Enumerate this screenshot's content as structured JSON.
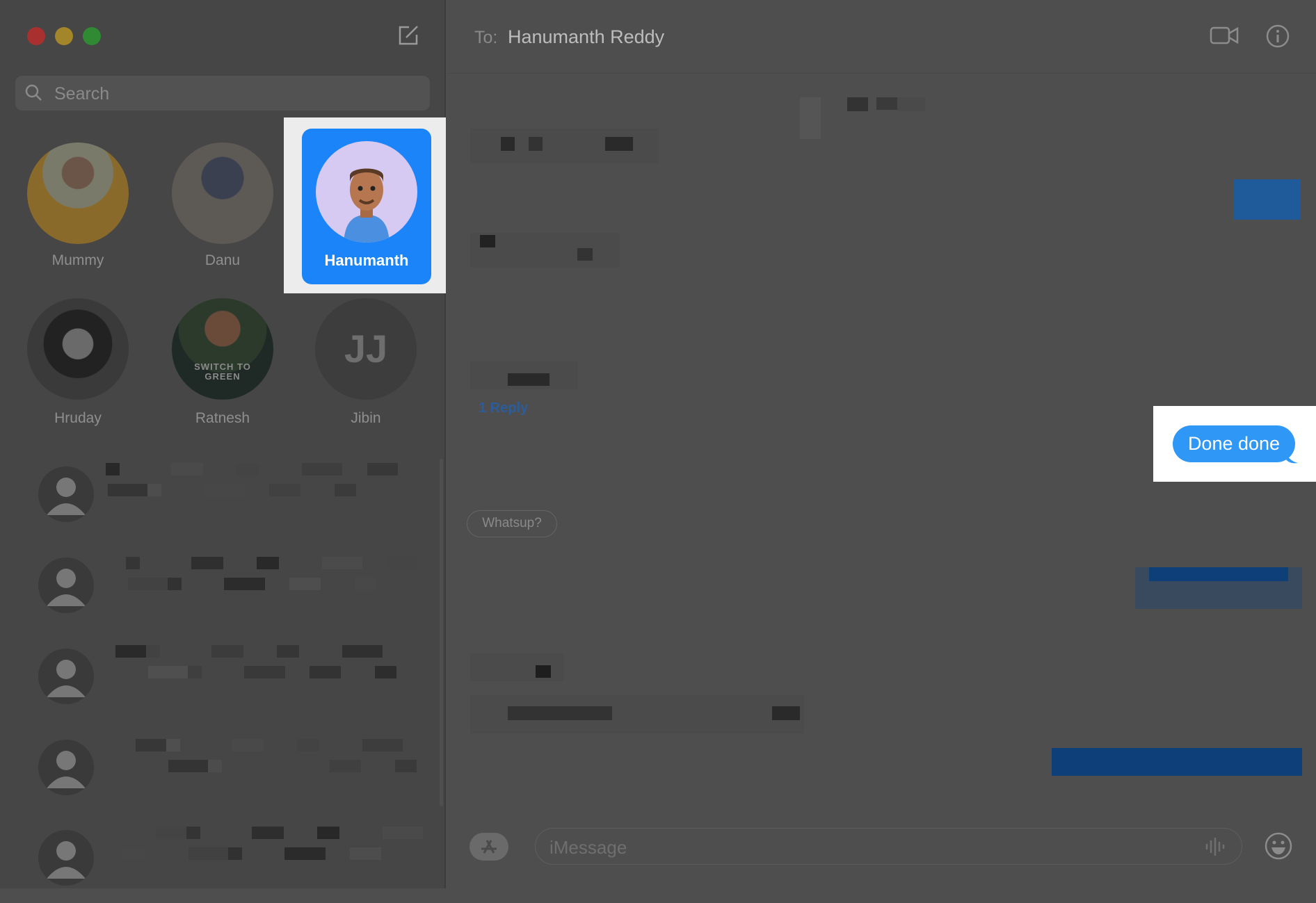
{
  "sidebar": {
    "search_placeholder": "Search",
    "pinned": [
      {
        "name": "Mummy"
      },
      {
        "name": "Danu"
      },
      {
        "name": "Hanumanth",
        "selected": true
      },
      {
        "name": "Hruday"
      },
      {
        "name": "Ratnesh"
      },
      {
        "name": "Jibin",
        "initials": "JJ"
      }
    ],
    "pinned_avatar_text": "SWITCH TO GREEN"
  },
  "header": {
    "to_label": "To:",
    "recipient": "Hanumanth Reddy"
  },
  "conversation": {
    "reply_count": "1 Reply",
    "highlighted_message": "Done done",
    "received_message": "Whatsup?"
  },
  "composer": {
    "placeholder": "iMessage"
  },
  "colors": {
    "accent": "#1a84f8",
    "bubble": "#2f97f5",
    "highlight": "#ececec"
  }
}
